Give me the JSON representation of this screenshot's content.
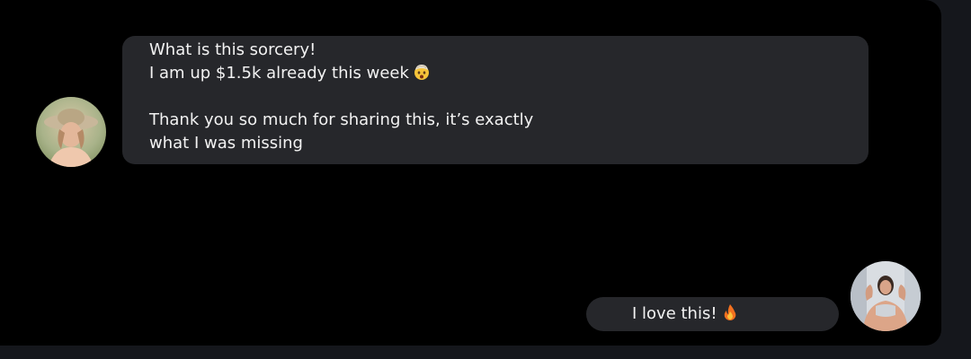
{
  "conversation": {
    "incoming": {
      "avatar_icon": "user-avatar-photo-icon",
      "lines": [
        "What is this sorcery!",
        "I am up $1.5k already this week",
        "Thank you so much for sharing this, it’s exactly",
        "what I was missing"
      ],
      "inline_emoji": "exploding-head-emoji-icon"
    },
    "outgoing": {
      "avatar_icon": "user-avatar-photo-icon",
      "text": "I love this!",
      "inline_emoji": "fire-emoji-icon"
    }
  },
  "colors": {
    "page_background": "#15171c",
    "chat_background": "#000000",
    "bubble_background": "#26272b",
    "text": "#f2f2f2"
  }
}
